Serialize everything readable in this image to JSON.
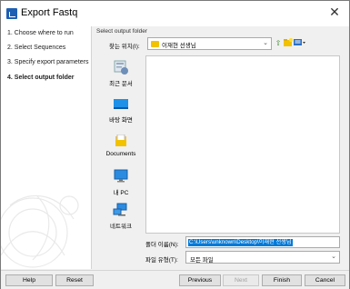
{
  "window": {
    "title": "Export Fastq",
    "close_glyph": "✕"
  },
  "steps": [
    {
      "label": "1.  Choose where to run"
    },
    {
      "label": "2.  Select Sequences"
    },
    {
      "label": "3.  Specify export parameters"
    },
    {
      "label": "4.  Select output folder"
    }
  ],
  "dialog": {
    "header": "Select output folder",
    "look_in_label": "찾는 위치(I):",
    "look_in_value": "이재현 선생님",
    "places": [
      {
        "label": "최근 문서",
        "icon": "recent-documents-icon"
      },
      {
        "label": "바탕 화면",
        "icon": "desktop-icon"
      },
      {
        "label": "Documents",
        "icon": "documents-folder-icon"
      },
      {
        "label": "내 PC",
        "icon": "this-pc-icon"
      },
      {
        "label": "네트워크",
        "icon": "network-icon"
      }
    ],
    "folder_name_label": "폴더 이름(N):",
    "folder_name_value": "C:\\Users\\unknown\\Desktop\\이재현 선생님",
    "file_type_label": "파일 유형(T):",
    "file_type_value": "모든 파일"
  },
  "buttons": {
    "help": "Help",
    "reset": "Reset",
    "previous": "Previous",
    "next": "Next",
    "finish": "Finish",
    "cancel": "Cancel"
  }
}
